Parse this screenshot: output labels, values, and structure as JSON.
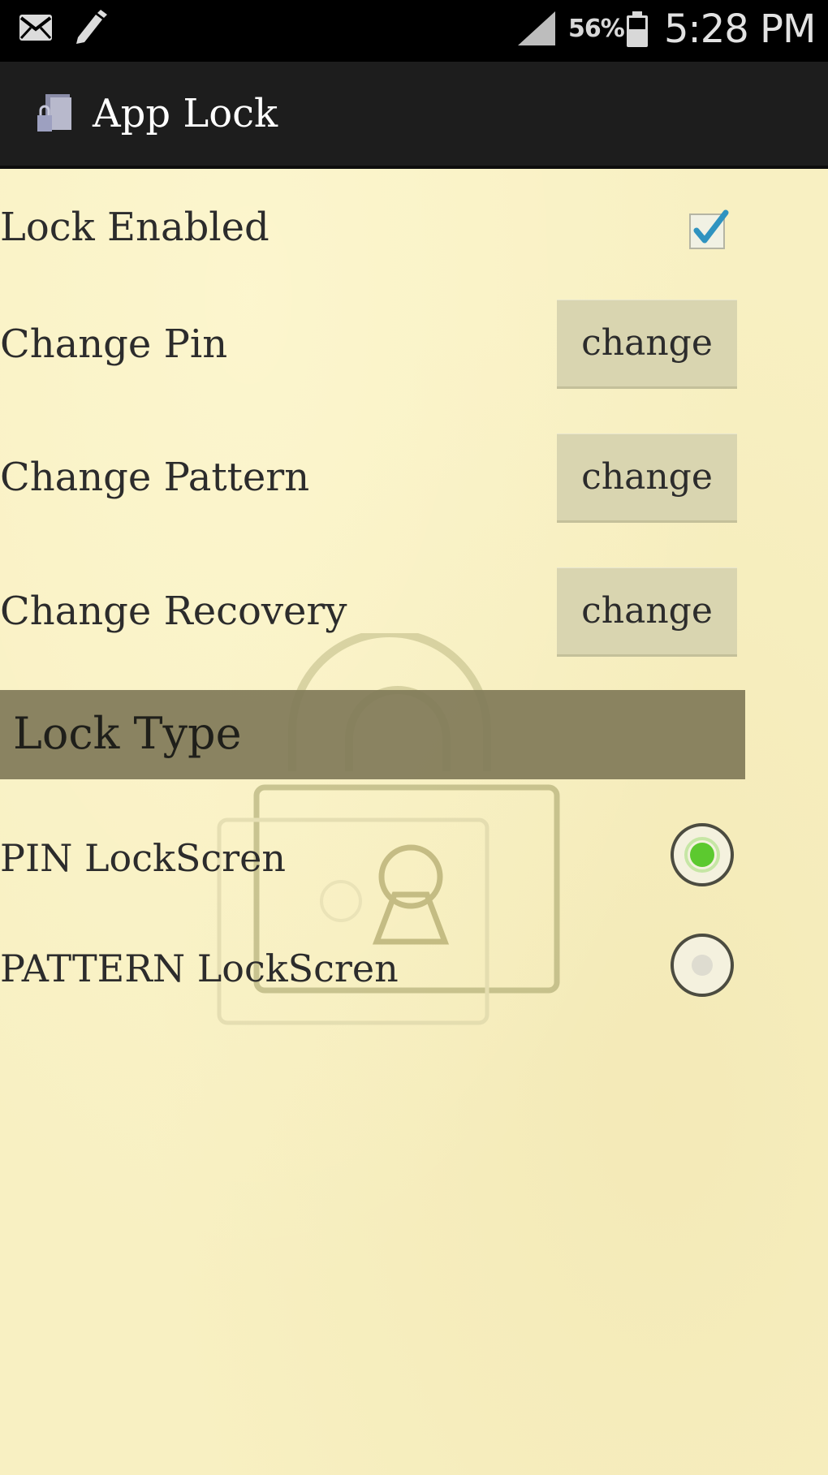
{
  "status_bar": {
    "battery_percent": "56%",
    "time": "5:28 PM",
    "icons": [
      "mail-icon",
      "edit-icon",
      "signal-icon",
      "battery-icon"
    ]
  },
  "action_bar": {
    "title": "App Lock",
    "icon": "app-lock-icon"
  },
  "settings": {
    "lock_enabled": {
      "label": "Lock Enabled",
      "checked": true
    },
    "change_pin": {
      "label": "Change Pin",
      "button": "change"
    },
    "change_pattern": {
      "label": "Change Pattern",
      "button": "change"
    },
    "change_recovery": {
      "label": "Change Recovery",
      "button": "change"
    }
  },
  "lock_type": {
    "header": "Lock Type",
    "options": [
      {
        "label": "PIN LockScren",
        "selected": true
      },
      {
        "label": "PATTERN LockScren",
        "selected": false
      }
    ]
  },
  "colors": {
    "background": "#f8f0c2",
    "status_bar": "#000000",
    "action_bar": "#1d1d1d",
    "button": "#d9d5b0",
    "section_header": "#807a58",
    "accent": "#3aa0c8",
    "radio_selected": "#5cc92f"
  }
}
